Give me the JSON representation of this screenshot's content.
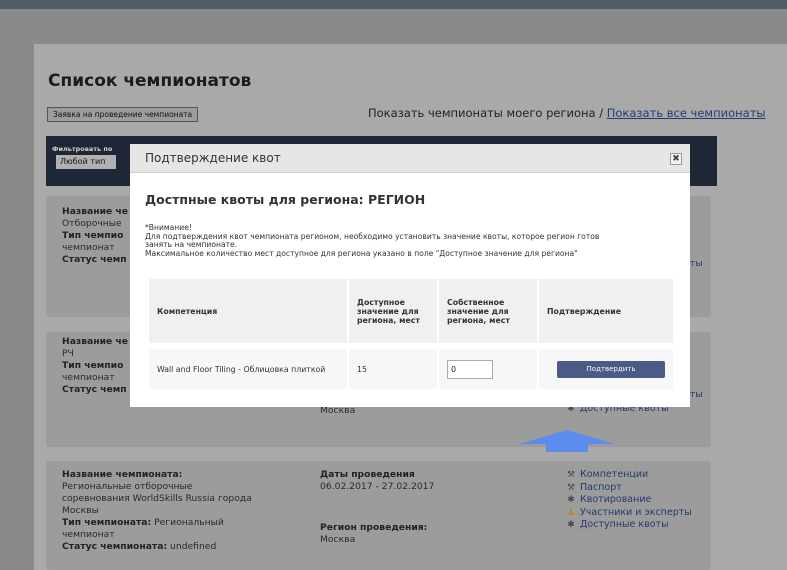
{
  "page": {
    "title": "Список чемпионатов",
    "request_button": "Заявка на проведение чемпионата",
    "show_my_region": "Показать чемпионаты моего региона",
    "separator": " / ",
    "show_all": "Показать все чемпионаты",
    "filter_label": "Фильтровать по",
    "filter_select": "Любой тип че"
  },
  "cards": [
    {
      "name_label": "Название че",
      "name_value": "Отборочные",
      "type_label": "Тип чемпио",
      "type_value": "чемпионат",
      "status_label": "Статус чемп",
      "right_text": "ты"
    },
    {
      "name_label": "Название че",
      "name_value": "РЧ",
      "type_label": "Тип чемпио",
      "type_value": "чемпионат",
      "status_label": "Статус чемп",
      "region_value": "Москва",
      "right_text": "ты",
      "quota_link": "Доступные квоты"
    },
    {
      "name_label": "Название чемпионата:",
      "name_lines": [
        "Региональные отборочные",
        "соревнования WorldSkills Russia города",
        "Москвы"
      ],
      "type_label": "Тип чемпионата:",
      "type_inline": " Региональный",
      "type_line2": "чемпионат",
      "status_label": "Статус чемпионата:",
      "status_value": " undefined",
      "dates_label": "Даты проведения",
      "dates_value": "06.02.2017 - 27.02.2017",
      "region_label": "Регион проведения:",
      "region_value": "Москва",
      "links": [
        "Компетенции",
        "Паспорт",
        "Квотирование",
        "Участники и эксперты",
        "Доступные квоты"
      ]
    }
  ],
  "modal": {
    "title": "Подтверждение квот",
    "close_symbol": "✖",
    "heading": "Достпные квоты для региона: РЕГИОН",
    "note": [
      "*Внимание!",
      "Для подтверждения квот чемпионата регионом, необходимо установить значение квоты, которое регион готов",
      "занять на чемпионате.",
      "Максимальное количество мест доступное для региона указано в поле \"Доступное значение для региона\""
    ],
    "table": {
      "headers": [
        "Компетенция",
        "Доступное значение для региона, мест",
        "Собственное значение для региона, мест",
        "Подтверждение"
      ],
      "rows": [
        {
          "competence": "Wall and Floor Tiling - Облицовка плиткой",
          "available": "15",
          "own_value": "0",
          "button": "Подтвердить"
        }
      ]
    }
  },
  "icons": {
    "wrench": "wrench-icon",
    "gear": "gear-icon",
    "person": "person-icon",
    "close": "close-icon",
    "arrow": "up-arrow-icon"
  },
  "colors": {
    "accent": "#4b5a86",
    "link": "#233c6a",
    "arrow": "#5b8def",
    "filter_bg": "#1e2736"
  }
}
